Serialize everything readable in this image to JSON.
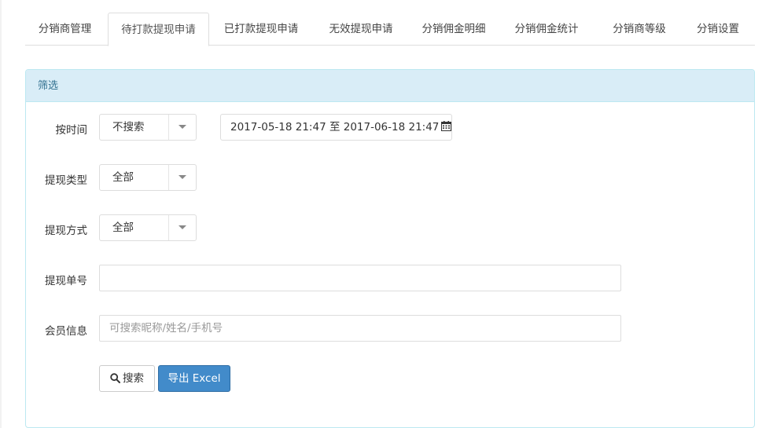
{
  "tabs": [
    {
      "label": "分销商管理"
    },
    {
      "label": "待打款提现申请"
    },
    {
      "label": "已打款提现申请"
    },
    {
      "label": "无效提现申请"
    },
    {
      "label": "分销佣金明细"
    },
    {
      "label": "分销佣金统计"
    },
    {
      "label": "分销商等级"
    },
    {
      "label": "分销设置"
    }
  ],
  "active_tab": "待打款提现申请",
  "filter": {
    "title": "筛选",
    "time_label": "按时间",
    "time_select": "不搜索",
    "date_range": "2017-05-18 21:47 至 2017-06-18 21:47",
    "type_label": "提现类型",
    "type_select": "全部",
    "method_label": "提现方式",
    "method_select": "全部",
    "order_label": "提现单号",
    "order_value": "",
    "member_label": "会员信息",
    "member_placeholder": "可搜索昵称/姓名/手机号",
    "search_button": "搜索",
    "export_button": "导出 Excel"
  },
  "colors": {
    "panel_header_bg": "#d9edf7",
    "panel_border": "#bce8f1",
    "panel_title": "#31708f",
    "primary": "#428bca"
  }
}
